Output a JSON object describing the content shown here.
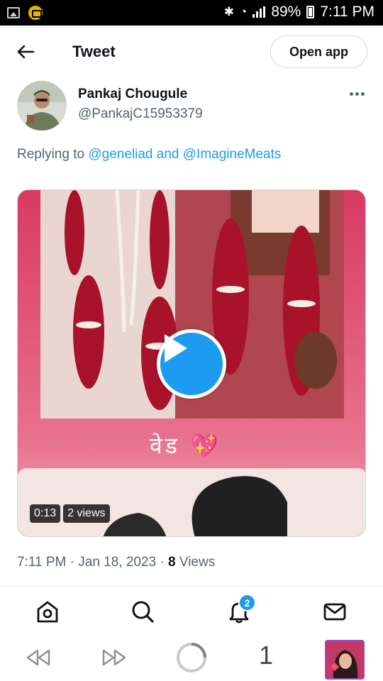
{
  "status_bar": {
    "battery": "89%",
    "time": "7:11 PM"
  },
  "header": {
    "back_icon": "arrow-left-icon",
    "title": "Tweet",
    "open_app": "Open app"
  },
  "tweet": {
    "author_name": "Pankaj Chougule",
    "author_handle": "@PankajC15953379",
    "more_icon": "more-horizontal-icon",
    "replying_prefix": "Replying to",
    "mention1": "@geneliad",
    "joiner": "and",
    "mention2": "@ImagineMeats",
    "media": {
      "caption": "वेड 💖",
      "duration": "0:13",
      "views": "2 views"
    },
    "time": "7:11 PM",
    "date": "Jan 18, 2023",
    "view_count": "8",
    "views_label": "Views"
  },
  "tabbar": {
    "items": [
      "home-icon",
      "search-icon",
      "notifications-icon",
      "messages-icon"
    ],
    "notification_count": "2"
  },
  "navbar": {
    "items": [
      "rewind-icon",
      "fast-forward-icon",
      "loading-icon"
    ],
    "tab_count": "1"
  },
  "colors": {
    "accent": "#1d9bf0",
    "text": "#0f1419",
    "secondary": "#536471"
  }
}
